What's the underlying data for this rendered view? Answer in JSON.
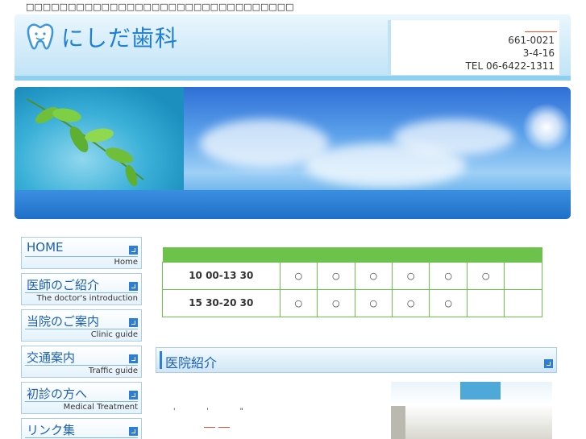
{
  "top_notice": "□□□□□□□□□□□□□□□□□□□□□□□□□□□□□□□□",
  "header": {
    "logo_text": "にしだ歯科",
    "contact": {
      "postal": "661-0021",
      "address": "3-4-16",
      "tel": "TEL 06-6422-1311"
    }
  },
  "sidebar": {
    "items": [
      {
        "jp": "HOME",
        "en": "Home"
      },
      {
        "jp": "医師のご紹介",
        "en": "The doctor's introduction"
      },
      {
        "jp": "当院のご案内",
        "en": "Clinic guide"
      },
      {
        "jp": "交通案内",
        "en": "Traffic guide"
      },
      {
        "jp": "初診の方へ",
        "en": "Medical Treatment"
      },
      {
        "jp": "リンク集",
        "en": ""
      }
    ]
  },
  "hours": {
    "rows": [
      {
        "time": "10  00-13  30",
        "marks": [
          "○",
          "○",
          "○",
          "○",
          "○",
          "○",
          ""
        ]
      },
      {
        "time": "15  30-20  30",
        "marks": [
          "○",
          "○",
          "○",
          "○",
          "○",
          "",
          ""
        ]
      }
    ]
  },
  "section": {
    "title": "医院紹介"
  },
  "body_quote_marks": "' '  \"",
  "colors": {
    "brand_blue": "#1a5fb8",
    "table_green": "#6cc24a",
    "header_light": "#bfe3f6"
  }
}
